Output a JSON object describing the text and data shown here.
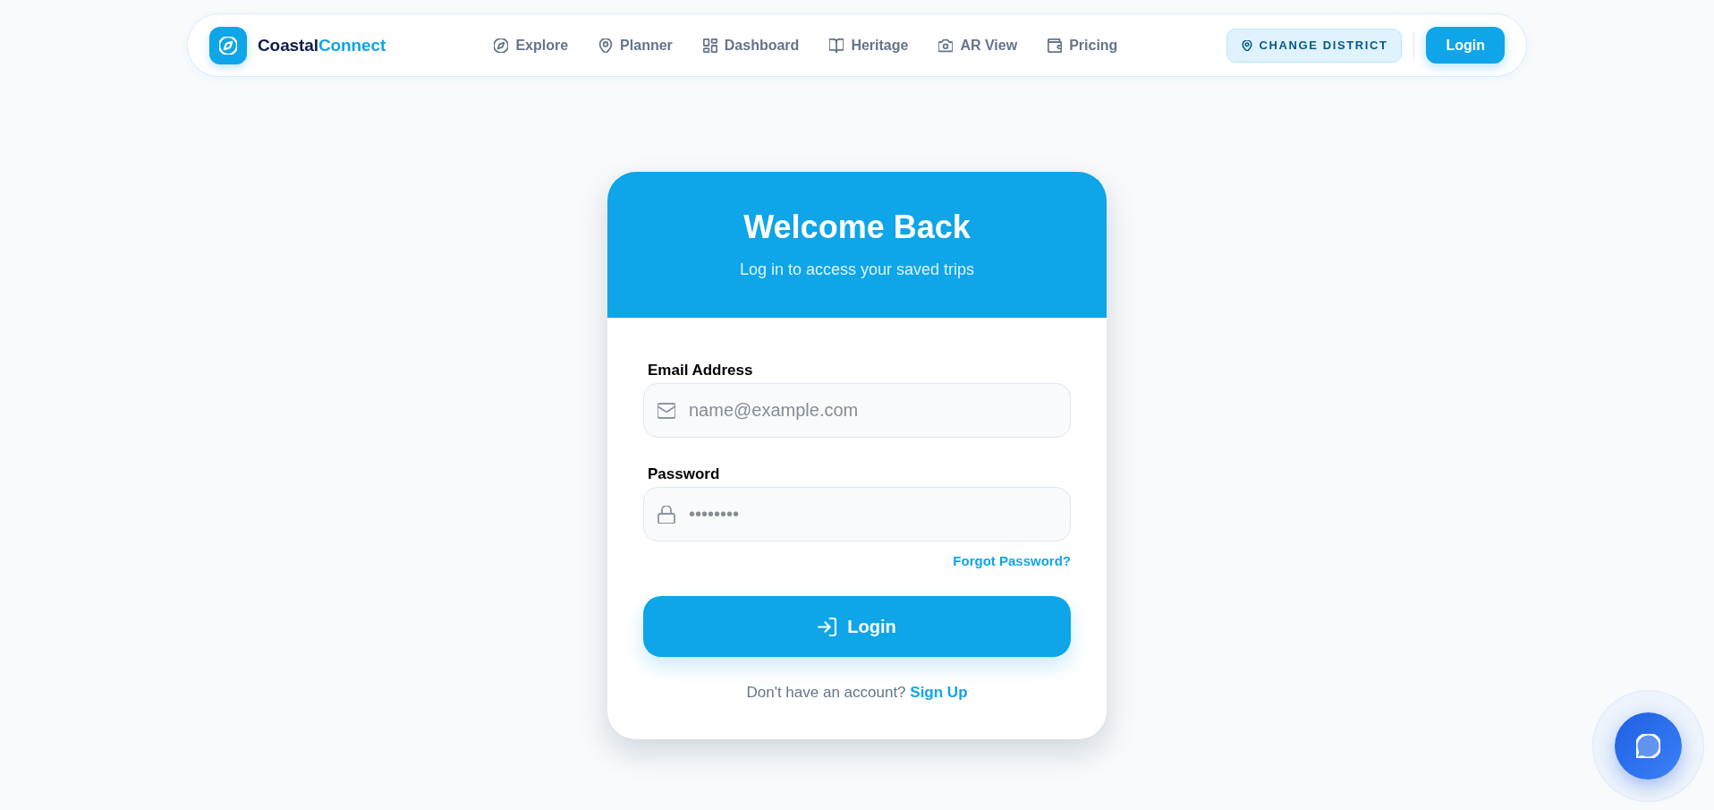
{
  "navbar": {
    "brand": {
      "name": "Coastal",
      "accent": "Connect"
    },
    "links": [
      {
        "kind": "explore",
        "label": "Explore",
        "selected": false
      },
      {
        "kind": "planner",
        "label": "Planner",
        "selected": false
      },
      {
        "kind": "dashboard",
        "label": "Dashboard",
        "selected": false
      },
      {
        "kind": "heritage",
        "label": "Heritage",
        "selected": false
      },
      {
        "kind": "ar",
        "label": "AR View",
        "selected": false
      },
      {
        "kind": "pricing",
        "label": "Pricing",
        "selected": false
      }
    ],
    "district_button": {
      "label": "CHANGE DISTRICT"
    },
    "login_button": {
      "label": "Login"
    }
  },
  "login_card": {
    "title": "Welcome Back",
    "subtitle": "Log in to access your saved trips",
    "fields": [
      {
        "kind": "email",
        "label": "Email Address",
        "placeholder": "name@example.com"
      },
      {
        "kind": "password",
        "label": "Password",
        "placeholder": "••••••••"
      }
    ],
    "forgot_link": "Forgot Password?",
    "submit_button": {
      "label": "Login"
    },
    "signup_prompt": {
      "text": "Don't have an account?",
      "link": "Sign Up"
    }
  }
}
